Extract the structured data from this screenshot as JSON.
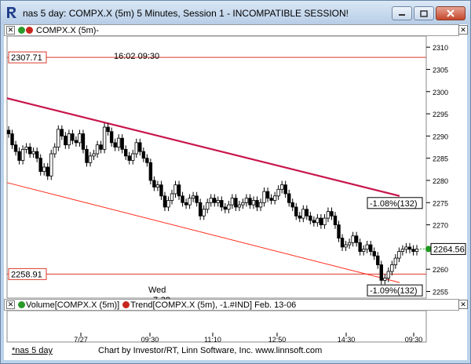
{
  "window": {
    "title": "nas 5 day: COMPX.X (5m) 5 Minutes, Session 1 - INCOMPATIBLE SESSION!",
    "buttons": {
      "minimize": "minimize-icon",
      "maximize": "maximize-icon",
      "close": "close-icon"
    }
  },
  "price_pane": {
    "header_label": "COMPX.X (5m)-",
    "session_time_label": "16:02  09:30",
    "day_label_line1": "Wed",
    "day_label_line2": "7-28",
    "left_price_tags": [
      "2307.71",
      "2258.91"
    ],
    "channel_labels": [
      "-1.08%(132)",
      "-1.09%(132)"
    ],
    "last_price": "2264.56",
    "y_ticks": [
      "2310",
      "2305",
      "2300",
      "2295",
      "2290",
      "2285",
      "2280",
      "2275",
      "2270",
      "2265",
      "2260",
      "2255"
    ]
  },
  "indicator_pane": {
    "header_label_volume": "Volume[COMPX.X (5m)]",
    "header_label_trend": "Trend[COMPX.X (5m), -1.#IND] Feb. 13-06",
    "x_ticks": [
      "7/27",
      "09:30",
      "11:10",
      "12:50",
      "14:30",
      "09:30"
    ]
  },
  "footer": {
    "tab_label": "*nas 5 day",
    "credit": "Chart by Investor/RT, Linn Software, Inc. www.linnsoft.com"
  },
  "colors": {
    "up_candle": "#ffffff",
    "down_candle": "#000000",
    "upper_channel": "#c8164c",
    "lower_channel": "#ff2a1a",
    "level_line": "#d93a2a",
    "last_price_marker": "#1f9a1f"
  },
  "chart_data": {
    "type": "candlestick",
    "title": "COMPX.X (5m)",
    "ylim": [
      2253.5,
      2312.5
    ],
    "series": [
      {
        "name": "COMPX.X (5m)",
        "close": [
          2290.5,
          2288.0,
          2286.5,
          2284.5,
          2287.0,
          2287.5,
          2286.0,
          2286.5,
          2285.0,
          2282.0,
          2283.0,
          2281.0,
          2286.0,
          2287.5,
          2291.5,
          2290.0,
          2288.0,
          2290.5,
          2289.0,
          2288.5,
          2290.5,
          2287.0,
          2284.0,
          2285.5,
          2286.0,
          2288.0,
          2287.0,
          2292.0,
          2291.0,
          2288.5,
          2287.5,
          2289.5,
          2287.0,
          2285.5,
          2284.5,
          2286.0,
          2288.5,
          2286.5,
          2285.0,
          2284.0,
          2280.0,
          2278.5,
          2279.0,
          2276.5,
          2274.0,
          2275.5,
          2277.0,
          2279.0,
          2276.5,
          2275.0,
          2274.5,
          2276.0,
          2276.5,
          2275.0,
          2272.0,
          2273.5,
          2275.0,
          2276.0,
          2275.0,
          2275.5,
          2274.0,
          2273.5,
          2274.5,
          2276.0,
          2274.0,
          2274.5,
          2275.0,
          2276.0,
          2274.5,
          2275.5,
          2274.0,
          2275.0,
          2277.5,
          2276.0,
          2275.5,
          2276.5,
          2278.0,
          2279.0,
          2277.0,
          2275.0,
          2274.0,
          2272.0,
          2271.5,
          2273.5,
          2272.0,
          2271.0,
          2270.5,
          2271.5,
          2270.0,
          2271.5,
          2273.0,
          2272.0,
          2270.0,
          2267.0,
          2265.0,
          2265.5,
          2266.0,
          2267.5,
          2266.0,
          2264.0,
          2264.5,
          2265.5,
          2264.0,
          2263.0,
          2261.0,
          2257.5,
          2258.0,
          2259.5,
          2261.0,
          2262.5,
          2264.0,
          2264.5,
          2265.0,
          2264.5,
          2264.0,
          2264.56
        ]
      }
    ],
    "levels": [
      2307.71,
      2258.91
    ],
    "channel": {
      "upper": {
        "start": 2298.5,
        "end": 2276.5
      },
      "lower": {
        "start": 2279.5,
        "end": 2257.0
      }
    }
  }
}
